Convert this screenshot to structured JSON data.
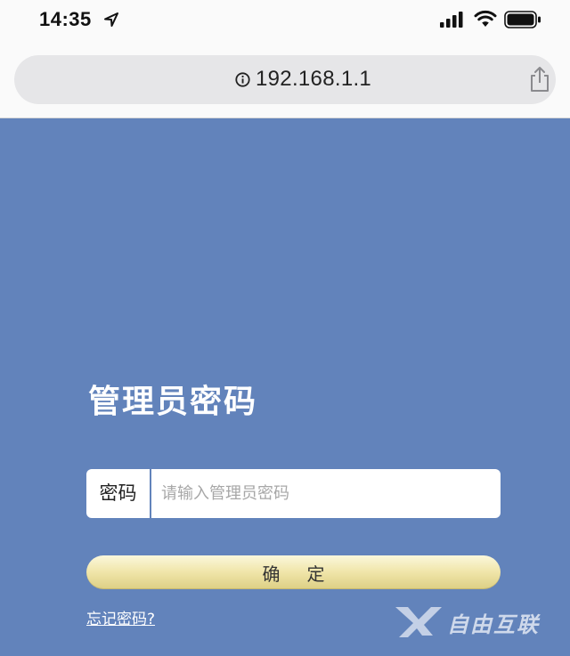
{
  "status_bar": {
    "time": "14:35",
    "icons": [
      "location-arrow-icon",
      "cellular-signal-icon",
      "wifi-icon",
      "battery-icon"
    ]
  },
  "address_bar": {
    "url": "192.168.1.1",
    "icons": [
      "info-icon",
      "share-icon"
    ]
  },
  "login": {
    "title": "管理员密码",
    "password_label": "密码",
    "password_placeholder": "请输入管理员密码",
    "password_value": "",
    "confirm_label": "确定",
    "forgot_link": "忘记密码?"
  },
  "watermark": {
    "text": "自由互联"
  },
  "colors": {
    "page_background": "#6283bb",
    "browser_chrome": "#fafafa",
    "address_bar": "#e6e6e8",
    "confirm_button": "#f1e7ad",
    "text_white": "#ffffff"
  }
}
